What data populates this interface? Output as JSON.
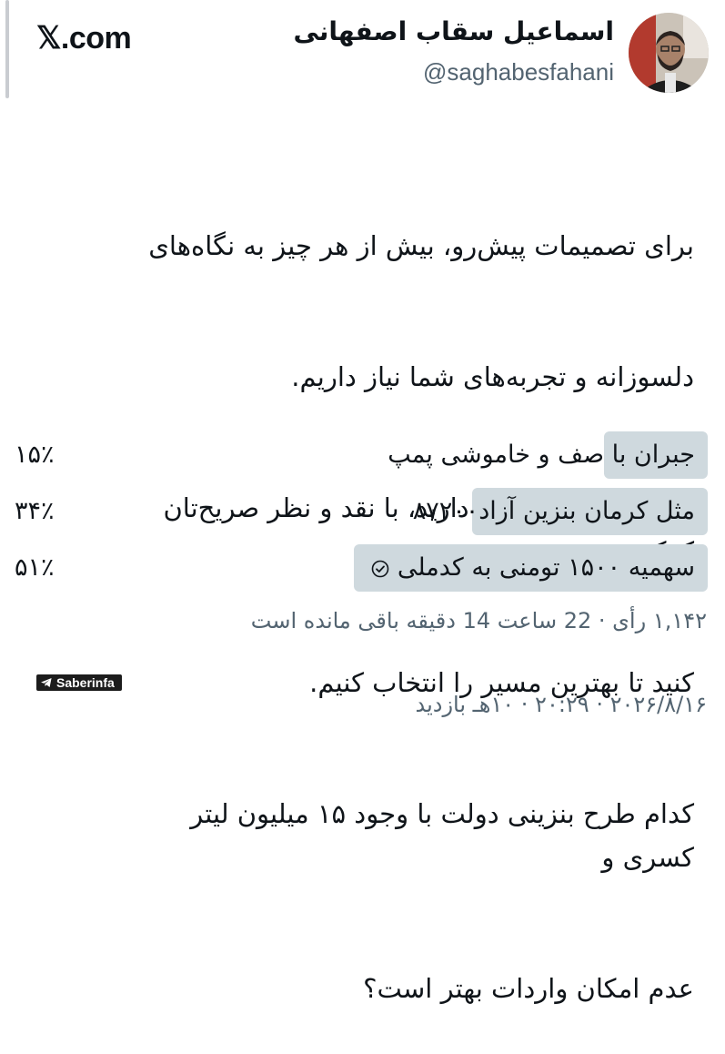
{
  "header": {
    "brand": "𝕏.com",
    "display_name": "اسماعیل سقاب اصفهانی",
    "handle": "@saghabesfahani"
  },
  "tweet": {
    "lines": [
      "برای تصمیمات پیش‌رو، بیش از هر چیز به نگاه‌های",
      "دلسوزانه و تجربه‌های شما نیاز داریم.",
      "اگر ایده یا پیشنهادی دارید، با نقد و نظر صریح‌تان کمک",
      "کنید تا بهترین مسیر را انتخاب کنیم.",
      "کدام طرح بنزینی دولت با وجود ۱۵ میلیون لیتر کسری و",
      "عدم امکان واردات بهتر است؟"
    ]
  },
  "poll": {
    "options": [
      {
        "label": "جبران با صف و خاموشی پمپ",
        "percent_label": "۱۵٪",
        "share": 0.15,
        "selected": false
      },
      {
        "label": "مثل کرمان بنزین آزاد۸۷۲۰۰",
        "percent_label": "۳۴٪",
        "share": 0.34,
        "selected": false
      },
      {
        "label": "سهمیه ۱۵۰۰ تومنی به کدملی",
        "percent_label": "۵۱٪",
        "share": 0.51,
        "selected": true
      }
    ],
    "meta": "۱,۱۴۲ رأی · 22 ساعت 14 دقیقه باقی مانده است"
  },
  "watermark": {
    "text": "Saberinfa",
    "icon": "telegram-icon"
  },
  "footer": {
    "meta": "۲۰۲۶/۸/۱۶ · ۲۰:۲۹ · ۱۰هـ بازدید"
  },
  "colors": {
    "poll_bar": "#cfd9de",
    "muted_text": "#536471"
  }
}
